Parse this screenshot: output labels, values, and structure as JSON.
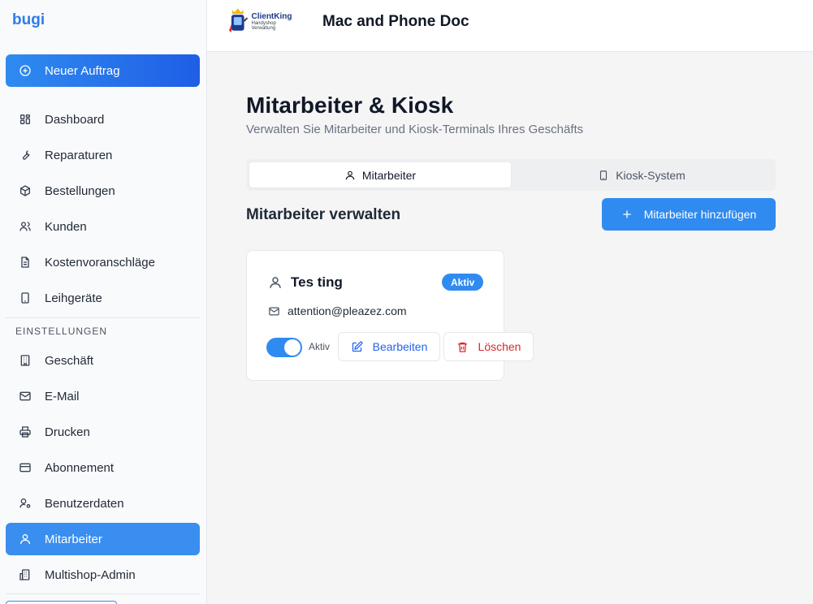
{
  "sidebar": {
    "brand": "bugi",
    "new_order": {
      "label": "Neuer Auftrag",
      "icon": "plus-circle-icon"
    },
    "items": [
      {
        "label": "Dashboard",
        "icon": "dashboard-icon"
      },
      {
        "label": "Reparaturen",
        "icon": "wrench-icon"
      },
      {
        "label": "Bestellungen",
        "icon": "package-icon"
      },
      {
        "label": "Kunden",
        "icon": "users-icon"
      },
      {
        "label": "Kostenvoranschläge",
        "icon": "document-icon"
      },
      {
        "label": "Leihgeräte",
        "icon": "tablet-icon"
      }
    ],
    "settings_label": "EINSTELLUNGEN",
    "settings_items": [
      {
        "label": "Geschäft",
        "icon": "building-icon"
      },
      {
        "label": "E-Mail",
        "icon": "mail-icon"
      },
      {
        "label": "Drucken",
        "icon": "printer-icon"
      },
      {
        "label": "Abonnement",
        "icon": "credit-card-icon"
      },
      {
        "label": "Benutzerdaten",
        "icon": "user-cog-icon"
      },
      {
        "label": "Mitarbeiter",
        "icon": "user-icon",
        "active": true
      },
      {
        "label": "Multishop-Admin",
        "icon": "buildings-icon"
      }
    ]
  },
  "header": {
    "logo_main": "ClientKing",
    "logo_sub": "Handyshop Verwaltung",
    "shop_name": "Mac and Phone Doc"
  },
  "main": {
    "title": "Mitarbeiter & Kiosk",
    "subtitle": "Verwalten Sie Mitarbeiter und Kiosk-Terminals Ihres Geschäfts",
    "tabs": [
      {
        "label": "Mitarbeiter",
        "icon": "user-icon",
        "active": true
      },
      {
        "label": "Kiosk-System",
        "icon": "tablet-icon",
        "active": false
      }
    ],
    "section_title": "Mitarbeiter verwalten",
    "add_button": "Mitarbeiter hinzufügen",
    "employee": {
      "name": "Tes ting",
      "status_badge": "Aktiv",
      "email": "attention@pleazez.com",
      "toggle_label": "Aktiv",
      "toggle_on": true,
      "edit_label": "Bearbeiten",
      "delete_label": "Löschen"
    }
  },
  "colors": {
    "accent": "#2f8bf0",
    "danger": "#dc2626",
    "link": "#2563eb"
  }
}
